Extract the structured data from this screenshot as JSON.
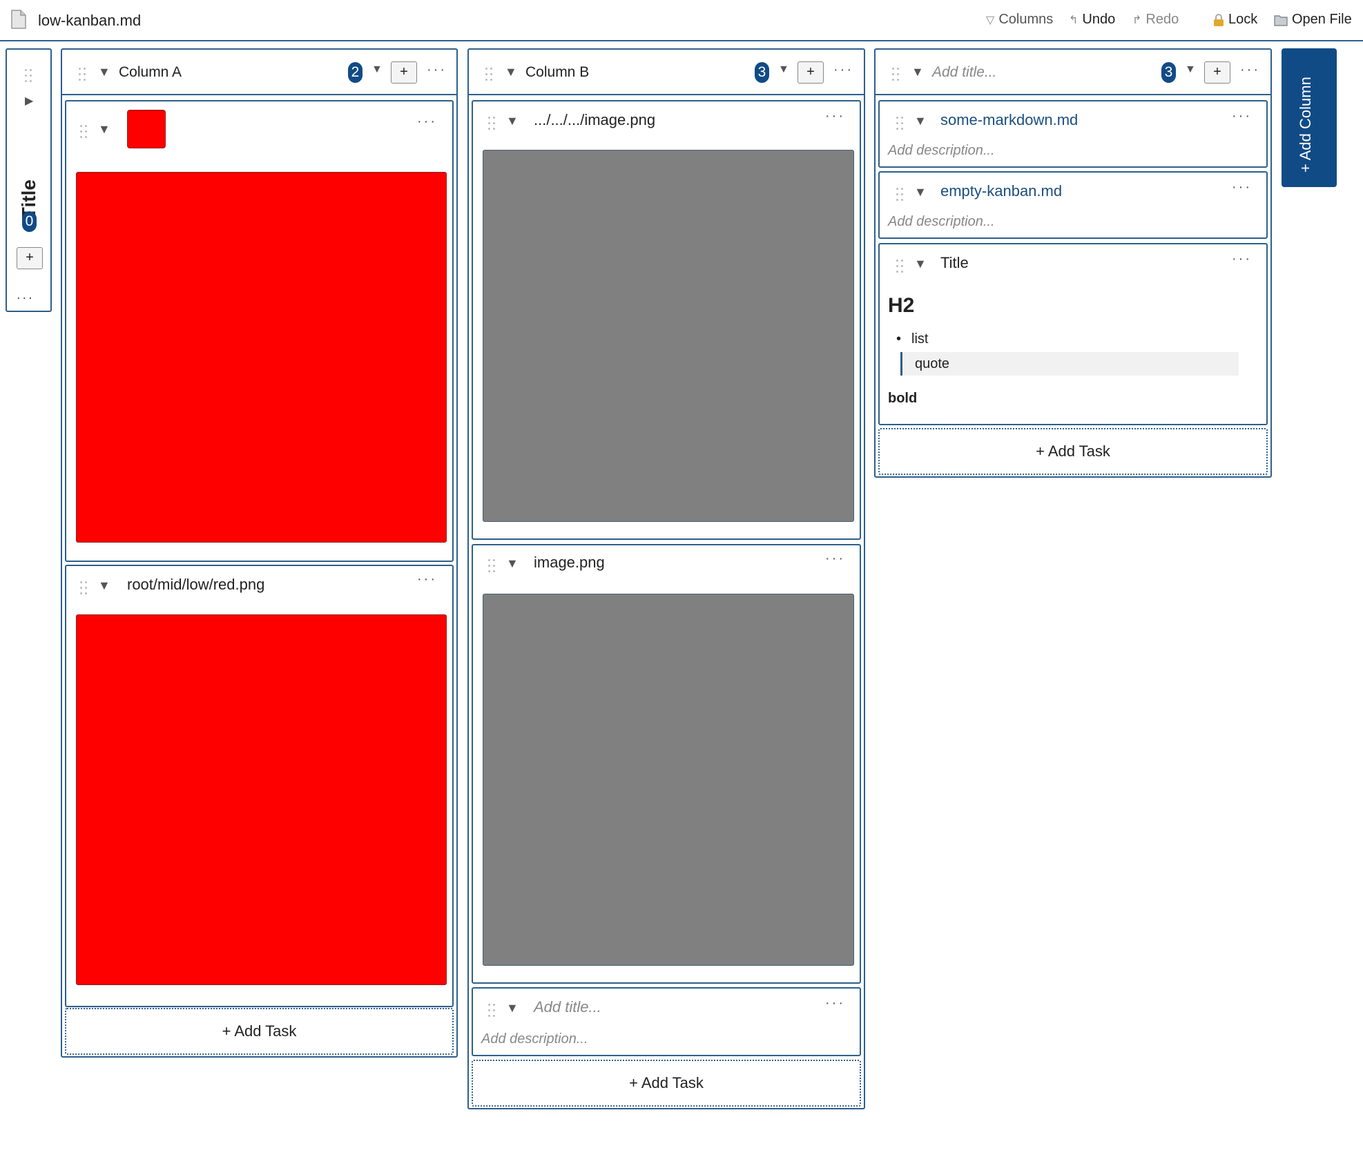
{
  "topbar": {
    "file_name": "low-kanban.md",
    "columns_label": "Columns",
    "undo_label": "Undo",
    "redo_label": "Redo",
    "lock_label": "Lock",
    "open_file_label": "Open File"
  },
  "collapsed_column": {
    "title": "Title",
    "count": "0",
    "add_label": "+",
    "more_label": "..."
  },
  "column_a": {
    "title": "Column A",
    "count": "2",
    "add_label": "+",
    "cards": [
      {
        "title": ""
      },
      {
        "title": "root/mid/low/red.png"
      }
    ],
    "add_task": "+ Add Task"
  },
  "column_b": {
    "title": "Column B",
    "count": "3",
    "add_label": "+",
    "cards": [
      {
        "title": ".../.../.../image.png"
      },
      {
        "title": "image.png"
      },
      {
        "title_placeholder": "Add title...",
        "description_placeholder": "Add description..."
      }
    ],
    "add_task": "+ Add Task"
  },
  "column_c": {
    "title_placeholder": "Add title...",
    "count": "3",
    "add_label": "+",
    "cards": [
      {
        "title": "some-markdown.md",
        "description_placeholder": "Add description..."
      },
      {
        "title": "empty-kanban.md",
        "description_placeholder": "Add description..."
      },
      {
        "title": "Title",
        "h2": "H2",
        "list_item": "list",
        "quote": "quote",
        "bold": "bold"
      }
    ],
    "add_task": "+ Add Task"
  },
  "add_column_label": "+ Add Column",
  "colors": {
    "accent": "#114b86",
    "border": "#2e5f8a",
    "image_red": "#ff0000",
    "image_gray": "#808080"
  }
}
